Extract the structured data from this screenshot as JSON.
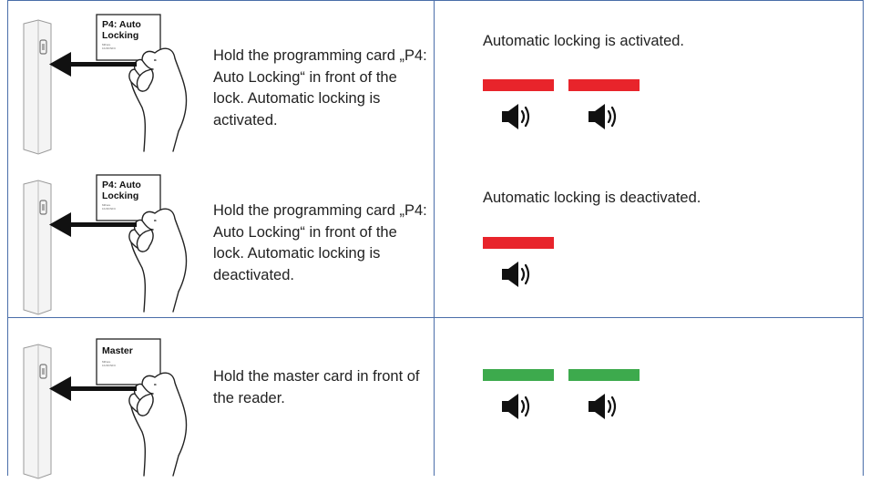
{
  "rows": [
    {
      "card_label": [
        "P4: Auto",
        "Locking"
      ],
      "card_small": [
        "MiFare",
        "1K/4K/NFC"
      ],
      "instruction": "Hold the programming card „P4: Auto Locking“ in front of the lock. Automatic locking is activated.",
      "result": "Automatic locking is activated.",
      "led_color": "#e8242b",
      "signals": 2
    },
    {
      "card_label": [
        "P4: Auto",
        "Locking"
      ],
      "card_small": [
        "MiFare",
        "1K/4K/NFC"
      ],
      "instruction": "Hold the programming card „P4: Auto Locking“ in front of the lock. Automatic locking is deactivated.",
      "result": "Automatic locking is deactivated.",
      "led_color": "#e8242b",
      "signals": 1
    },
    {
      "card_label": [
        "Master"
      ],
      "card_small": [
        "MiFare",
        "1K/4K/NFC"
      ],
      "instruction": "Hold the master card in front of the reader.",
      "result": "",
      "led_color": "#3daa4d",
      "signals": 2
    }
  ],
  "colors": {
    "grid": "#4a6ea9",
    "led_red": "#e8242b",
    "led_green": "#3daa4d",
    "speaker": "#111111"
  },
  "icons": {
    "lock": "wall-reader-icon",
    "hand": "hand-holding-card-icon",
    "arrow": "left-arrow-icon",
    "speaker": "speaker-icon"
  }
}
